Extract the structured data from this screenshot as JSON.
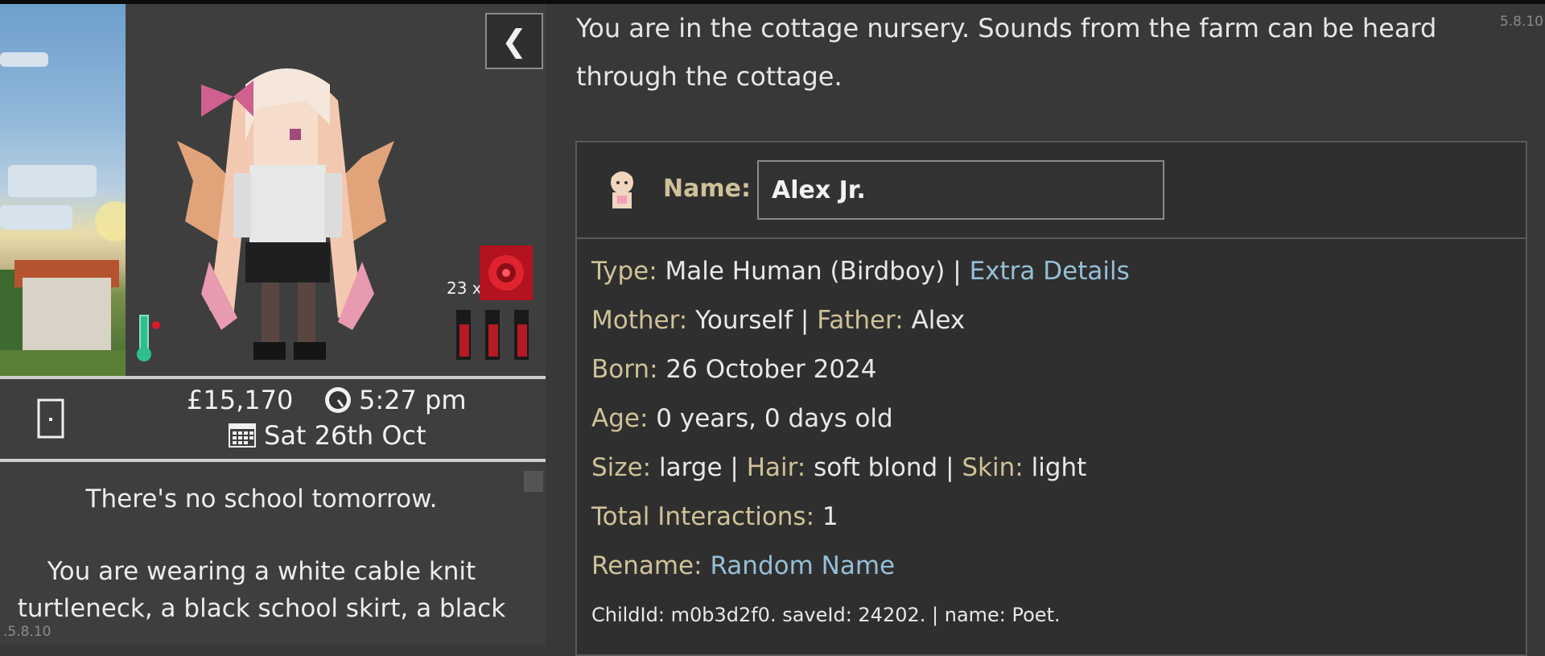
{
  "sidebar": {
    "toggle_icon": "chevron-left-icon",
    "chest_count": "23 x",
    "money": "£15,170",
    "time": "5:27 pm",
    "date": "Sat 26th Oct",
    "school_note": "There's no school tomorrow.",
    "wearing": "You are wearing a white cable knit turtleneck, a black school skirt, a black",
    "version": ".5.8.10"
  },
  "main": {
    "location": "You are in the cottage nursery. Sounds from the farm can be heard through the cottage.",
    "version": "5.8.10",
    "child": {
      "name_label": "Name:",
      "name_value": "Alex Jr.",
      "type_label": "Type:",
      "type_value": "Male Human (Birdboy)",
      "extra_details_link": "Extra Details",
      "mother_label": "Mother:",
      "mother_value": "Yourself",
      "father_label": "Father:",
      "father_value": "Alex",
      "born_label": "Born:",
      "born_value": "26 October 2024",
      "age_label": "Age:",
      "age_value": "0 years, 0 days old",
      "size_label": "Size:",
      "size_value": "large",
      "hair_label": "Hair:",
      "hair_value": "soft blond",
      "skin_label": "Skin:",
      "skin_value": "light",
      "interactions_label": "Total Interactions:",
      "interactions_value": "1",
      "rename_label": "Rename:",
      "rename_link": "Random Name",
      "debug_line": "ChildId: m0b3d2f0. saveId: 24202. | name: Poet."
    }
  },
  "colors": {
    "label": "#cfc198",
    "link": "#97bfd8",
    "background": "#383838",
    "card": "#2f2f2f"
  }
}
